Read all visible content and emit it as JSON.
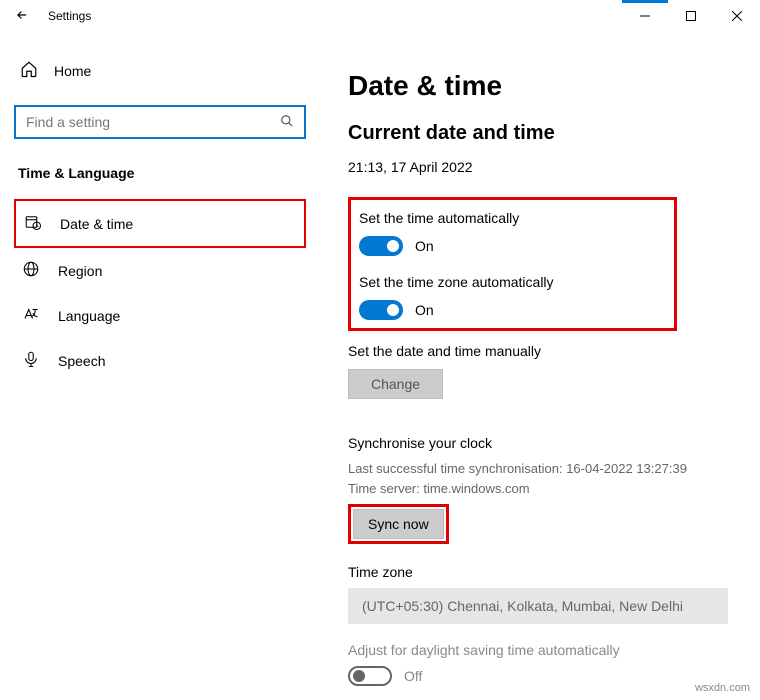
{
  "window": {
    "title": "Settings"
  },
  "sidebar": {
    "home_label": "Home",
    "search_placeholder": "Find a setting",
    "category": "Time & Language",
    "items": [
      {
        "label": "Date & time"
      },
      {
        "label": "Region"
      },
      {
        "label": "Language"
      },
      {
        "label": "Speech"
      }
    ]
  },
  "main": {
    "title": "Date & time",
    "current_header": "Current date and time",
    "current_value": "21:13, 17 April 2022",
    "auto_time_label": "Set the time automatically",
    "auto_time_state": "On",
    "auto_tz_label": "Set the time zone automatically",
    "auto_tz_state": "On",
    "manual_label": "Set the date and time manually",
    "change_button": "Change",
    "sync_header": "Synchronise your clock",
    "sync_last": "Last successful time synchronisation: 16-04-2022 13:27:39",
    "sync_server": "Time server: time.windows.com",
    "sync_button": "Sync now",
    "tz_header": "Time zone",
    "tz_value": "(UTC+05:30) Chennai, Kolkata, Mumbai, New Delhi",
    "dst_label": "Adjust for daylight saving time automatically",
    "dst_state": "Off"
  },
  "watermark": "wsxdn.com"
}
